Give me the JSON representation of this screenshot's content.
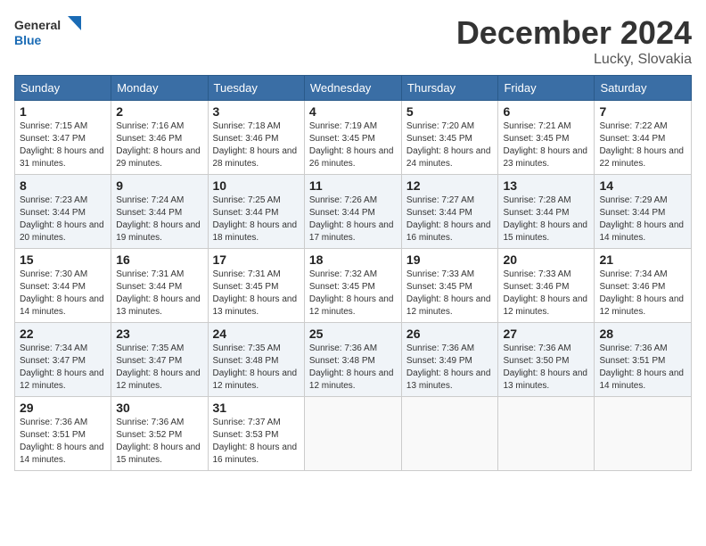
{
  "logo": {
    "text_general": "General",
    "text_blue": "Blue"
  },
  "title": "December 2024",
  "location": "Lucky, Slovakia",
  "days_of_week": [
    "Sunday",
    "Monday",
    "Tuesday",
    "Wednesday",
    "Thursday",
    "Friday",
    "Saturday"
  ],
  "weeks": [
    [
      {
        "day": "1",
        "sunrise": "7:15 AM",
        "sunset": "3:47 PM",
        "daylight": "8 hours and 31 minutes."
      },
      {
        "day": "2",
        "sunrise": "7:16 AM",
        "sunset": "3:46 PM",
        "daylight": "8 hours and 29 minutes."
      },
      {
        "day": "3",
        "sunrise": "7:18 AM",
        "sunset": "3:46 PM",
        "daylight": "8 hours and 28 minutes."
      },
      {
        "day": "4",
        "sunrise": "7:19 AM",
        "sunset": "3:45 PM",
        "daylight": "8 hours and 26 minutes."
      },
      {
        "day": "5",
        "sunrise": "7:20 AM",
        "sunset": "3:45 PM",
        "daylight": "8 hours and 24 minutes."
      },
      {
        "day": "6",
        "sunrise": "7:21 AM",
        "sunset": "3:45 PM",
        "daylight": "8 hours and 23 minutes."
      },
      {
        "day": "7",
        "sunrise": "7:22 AM",
        "sunset": "3:44 PM",
        "daylight": "8 hours and 22 minutes."
      }
    ],
    [
      {
        "day": "8",
        "sunrise": "7:23 AM",
        "sunset": "3:44 PM",
        "daylight": "8 hours and 20 minutes."
      },
      {
        "day": "9",
        "sunrise": "7:24 AM",
        "sunset": "3:44 PM",
        "daylight": "8 hours and 19 minutes."
      },
      {
        "day": "10",
        "sunrise": "7:25 AM",
        "sunset": "3:44 PM",
        "daylight": "8 hours and 18 minutes."
      },
      {
        "day": "11",
        "sunrise": "7:26 AM",
        "sunset": "3:44 PM",
        "daylight": "8 hours and 17 minutes."
      },
      {
        "day": "12",
        "sunrise": "7:27 AM",
        "sunset": "3:44 PM",
        "daylight": "8 hours and 16 minutes."
      },
      {
        "day": "13",
        "sunrise": "7:28 AM",
        "sunset": "3:44 PM",
        "daylight": "8 hours and 15 minutes."
      },
      {
        "day": "14",
        "sunrise": "7:29 AM",
        "sunset": "3:44 PM",
        "daylight": "8 hours and 14 minutes."
      }
    ],
    [
      {
        "day": "15",
        "sunrise": "7:30 AM",
        "sunset": "3:44 PM",
        "daylight": "8 hours and 14 minutes."
      },
      {
        "day": "16",
        "sunrise": "7:31 AM",
        "sunset": "3:44 PM",
        "daylight": "8 hours and 13 minutes."
      },
      {
        "day": "17",
        "sunrise": "7:31 AM",
        "sunset": "3:45 PM",
        "daylight": "8 hours and 13 minutes."
      },
      {
        "day": "18",
        "sunrise": "7:32 AM",
        "sunset": "3:45 PM",
        "daylight": "8 hours and 12 minutes."
      },
      {
        "day": "19",
        "sunrise": "7:33 AM",
        "sunset": "3:45 PM",
        "daylight": "8 hours and 12 minutes."
      },
      {
        "day": "20",
        "sunrise": "7:33 AM",
        "sunset": "3:46 PM",
        "daylight": "8 hours and 12 minutes."
      },
      {
        "day": "21",
        "sunrise": "7:34 AM",
        "sunset": "3:46 PM",
        "daylight": "8 hours and 12 minutes."
      }
    ],
    [
      {
        "day": "22",
        "sunrise": "7:34 AM",
        "sunset": "3:47 PM",
        "daylight": "8 hours and 12 minutes."
      },
      {
        "day": "23",
        "sunrise": "7:35 AM",
        "sunset": "3:47 PM",
        "daylight": "8 hours and 12 minutes."
      },
      {
        "day": "24",
        "sunrise": "7:35 AM",
        "sunset": "3:48 PM",
        "daylight": "8 hours and 12 minutes."
      },
      {
        "day": "25",
        "sunrise": "7:36 AM",
        "sunset": "3:48 PM",
        "daylight": "8 hours and 12 minutes."
      },
      {
        "day": "26",
        "sunrise": "7:36 AM",
        "sunset": "3:49 PM",
        "daylight": "8 hours and 13 minutes."
      },
      {
        "day": "27",
        "sunrise": "7:36 AM",
        "sunset": "3:50 PM",
        "daylight": "8 hours and 13 minutes."
      },
      {
        "day": "28",
        "sunrise": "7:36 AM",
        "sunset": "3:51 PM",
        "daylight": "8 hours and 14 minutes."
      }
    ],
    [
      {
        "day": "29",
        "sunrise": "7:36 AM",
        "sunset": "3:51 PM",
        "daylight": "8 hours and 14 minutes."
      },
      {
        "day": "30",
        "sunrise": "7:36 AM",
        "sunset": "3:52 PM",
        "daylight": "8 hours and 15 minutes."
      },
      {
        "day": "31",
        "sunrise": "7:37 AM",
        "sunset": "3:53 PM",
        "daylight": "8 hours and 16 minutes."
      },
      null,
      null,
      null,
      null
    ]
  ],
  "labels": {
    "sunrise": "Sunrise:",
    "sunset": "Sunset:",
    "daylight": "Daylight:"
  }
}
